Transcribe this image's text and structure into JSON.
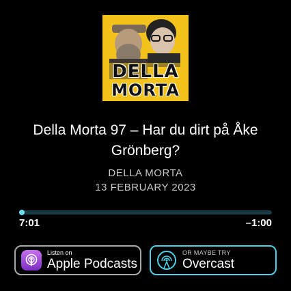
{
  "artwork": {
    "word_top": "DELLA",
    "word_bottom": "MORTA",
    "icon": "podcast-artwork"
  },
  "episode": {
    "title": "Della Morta 97 – Har du dirt på Åke Grönberg?",
    "show": "DELLA MORTA",
    "date": "13 FEBRUARY 2023"
  },
  "player": {
    "elapsed": "7:01",
    "remaining": "–1:00",
    "progress_fraction": 0.01,
    "track_color": "#1a3b45",
    "fill_color": "#4fd0e8"
  },
  "buttons": {
    "apple": {
      "small": "Listen on",
      "big": "Apple Podcasts",
      "icon": "apple-podcasts-icon",
      "border_color": "#a9a9a9"
    },
    "overcast": {
      "small": "OR MAYBE TRY",
      "big": "Overcast",
      "icon": "overcast-icon",
      "border_color": "#4fd0e8"
    }
  }
}
